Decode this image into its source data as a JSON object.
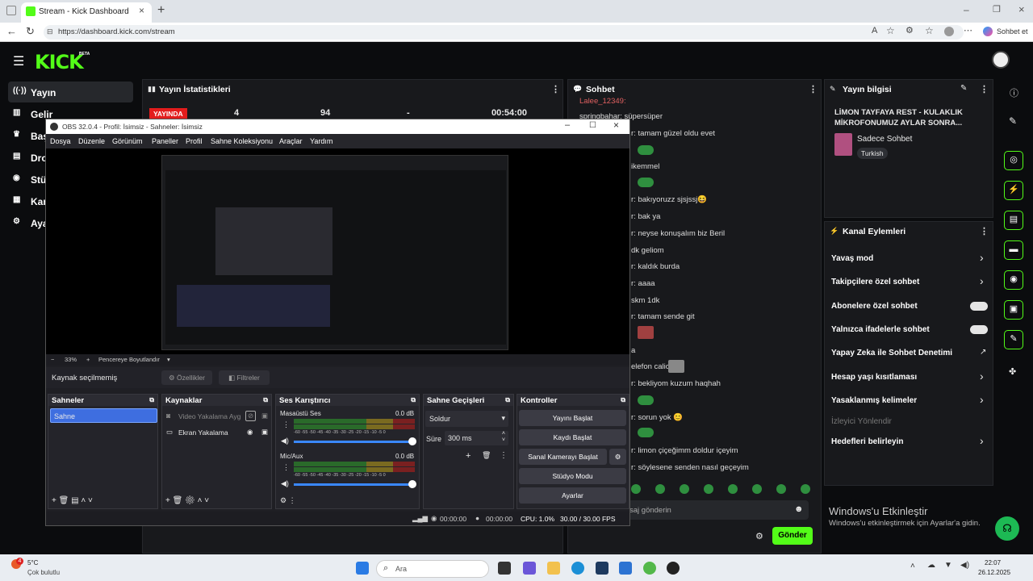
{
  "browser": {
    "tab_title": "Stream - Kick Dashboard",
    "url": "https://dashboard.kick.com/stream",
    "sohbet_et": "Sohbet et"
  },
  "kick": {
    "logo": "KICK",
    "logo_badge": "BETA",
    "nav": [
      "Yayın",
      "Gelir",
      "Baş",
      "Dro",
      "Stü",
      "Kan",
      "Aya"
    ],
    "stats": {
      "title": "Yayın İstatistikleri",
      "live_badge": "YAYINDA",
      "values": [
        "4",
        "94",
        "-",
        "00:54:00"
      ]
    },
    "chat": {
      "title": "Sohbet",
      "lines": [
        "Lalee_12349:",
        "springbahar: süpersüper",
        "r: tamam güzel oldu evet",
        "ikemmel",
        "r: bakıyoruzz sjsjssj😆",
        "r: bak ya",
        "r: neyse konuşalım biz Beril",
        "dk geliom",
        "r: kaldık burda",
        "r: aaaa",
        "skm 1dk",
        "r: tamam sende git",
        "a",
        "elefon calio",
        "r: bekliyom kuzum haqhah",
        "r: sorun yok 😊",
        "r: limon çiçeğimm doldur içeyim",
        "r: söylesene senden nasıl geçeyim"
      ],
      "input_placeholder": "saj gönderin",
      "send_label": "Gönder"
    },
    "stream_info": {
      "title": "Yayın bilgisi",
      "stream_title": "LİMON TAYFAYA REST - KULAKLIK MİKROFONUMUZ AYLAR SONRA...",
      "category": "Sadece Sohbet",
      "language": "Turkish"
    },
    "channel_actions": {
      "title": "Kanal Eylemleri",
      "items": [
        {
          "label": "Yavaş mod",
          "control": "chevron"
        },
        {
          "label": "Takipçilere özel sohbet",
          "control": "chevron"
        },
        {
          "label": "Abonelere özel sohbet",
          "control": "toggle"
        },
        {
          "label": "Yalnızca ifadelerle sohbet",
          "control": "toggle"
        },
        {
          "label": "Yapay Zeka ile Sohbet Denetimi",
          "control": "external"
        },
        {
          "label": "Hesap yaşı kısıtlaması",
          "control": "chevron"
        },
        {
          "label": "Yasaklanmış kelimeler",
          "control": "chevron"
        },
        {
          "label": "İzleyici Yönlendir",
          "control": "none"
        },
        {
          "label": "Hedefleri belirleyin",
          "control": "chevron"
        }
      ]
    },
    "watermark": {
      "line1": "Windows'u Etkinleştir",
      "line2": "Windows'u etkinleştirmek için Ayarlar'a gidin."
    }
  },
  "obs": {
    "window_title": "OBS 32.0.4 - Profil: İsimsiz - Sahneler: İsimsiz",
    "menu": [
      "Dosya",
      "Düzenle",
      "Görünüm",
      "Paneller",
      "Profil",
      "Sahne Koleksiyonu",
      "Araçlar",
      "Yardım"
    ],
    "zoom": "33%",
    "fit_label": "Pencereye Boyutlandır",
    "no_source": "Kaynak seçilmemiş",
    "properties": "Özellikler",
    "filters": "Filtreler",
    "docks": {
      "scenes": {
        "title": "Sahneler",
        "items": [
          "Sahne"
        ]
      },
      "sources": {
        "title": "Kaynaklar",
        "items": [
          "Video Yakalama Ayg",
          "Ekran Yakalama"
        ]
      },
      "mixer": {
        "title": "Ses Karıştırıcı",
        "channels": [
          {
            "name": "Masaüstü Ses",
            "db": "0.0 dB",
            "level": 0.82
          },
          {
            "name": "Mic/Aux",
            "db": "0.0 dB",
            "level": 0.78
          }
        ],
        "scale": "-60 -55 -50 -45 -40 -35 -30 -25 -20 -15 -10 -5 0"
      },
      "transitions": {
        "title": "Sahne Geçişleri",
        "type": "Soldur",
        "duration_label": "Süre",
        "duration": "300 ms"
      },
      "controls": {
        "title": "Kontroller",
        "buttons": [
          "Yayını Başlat",
          "Kaydı Başlat",
          "Sanal Kamerayı Başlat",
          "Stüdyo Modu",
          "Ayarlar"
        ]
      }
    },
    "status": {
      "stream_time": "00:00:00",
      "rec_time": "00:00:00",
      "cpu": "CPU: 1.0%",
      "fps": "30.00 / 30.00 FPS"
    }
  },
  "taskbar": {
    "weather_temp": "5°C",
    "weather_desc": "Çok bulutlu",
    "search": "Ara",
    "time": "22:07",
    "date": "26.12.2025",
    "notification_count": "4"
  }
}
